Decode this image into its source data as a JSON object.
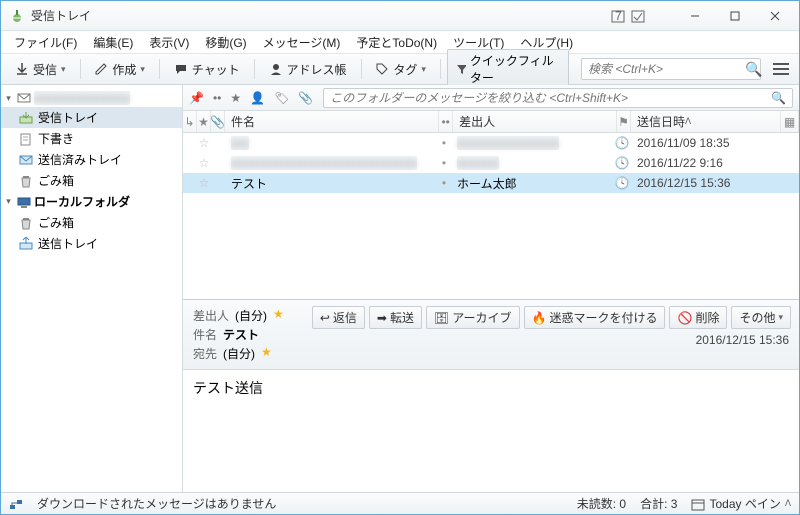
{
  "app": {
    "title": "受信トレイ"
  },
  "menu": {
    "file": "ファイル(F)",
    "edit": "編集(E)",
    "view": "表示(V)",
    "go": "移動(G)",
    "message": "メッセージ(M)",
    "todo": "予定とToDo(N)",
    "tools": "ツール(T)",
    "help": "ヘルプ(H)"
  },
  "toolbar": {
    "receive": "受信",
    "compose": "作成",
    "chat": "チャット",
    "address": "アドレス帳",
    "tag": "タグ",
    "quickfilter": "クイックフィルター"
  },
  "search": {
    "placeholder": "検索 <Ctrl+K>"
  },
  "sidebar": {
    "account_blur": "xxxxxxxxxxxxxxxx",
    "inbox": "受信トレイ",
    "drafts": "下書き",
    "sent": "送信済みトレイ",
    "trash": "ごみ箱",
    "local": "ローカルフォルダ",
    "local_trash": "ごみ箱",
    "local_outbox": "送信トレイ"
  },
  "filter": {
    "placeholder": "このフォルダーのメッセージを絞り込む <Ctrl+Shift+K>"
  },
  "columns": {
    "subject": "件名",
    "from": "差出人",
    "date": "送信日時"
  },
  "messages": [
    {
      "subject_blur": "xxx",
      "from_blur": "xxxxxxxxxxxxxxxxx",
      "date": "2016/11/09 18:35",
      "selected": false
    },
    {
      "subject_blur": "xxxxxxxxxxxxxxxxxxxxxxxxxxxxxxx",
      "from_blur": "xxxxxxx",
      "date": "2016/11/22 9:16",
      "selected": false
    },
    {
      "subject": "テスト",
      "from": "ホーム太郎",
      "date": "2016/12/15 15:36",
      "selected": true
    }
  ],
  "header": {
    "from_label": "差出人",
    "from_value": "(自分)",
    "subject_label": "件名",
    "subject_value": "テスト",
    "to_label": "宛先",
    "to_value": "(自分)",
    "date": "2016/12/15 15:36"
  },
  "actions": {
    "reply": "返信",
    "forward": "転送",
    "archive": "アーカイブ",
    "junk": "迷惑マークを付ける",
    "delete": "削除",
    "other": "その他"
  },
  "bodytext": "テスト送信",
  "status": {
    "left": "ダウンロードされたメッセージはありません",
    "unread_label": "未読数:",
    "unread": "0",
    "total_label": "合計:",
    "total": "3",
    "today": "Today ペイン"
  }
}
